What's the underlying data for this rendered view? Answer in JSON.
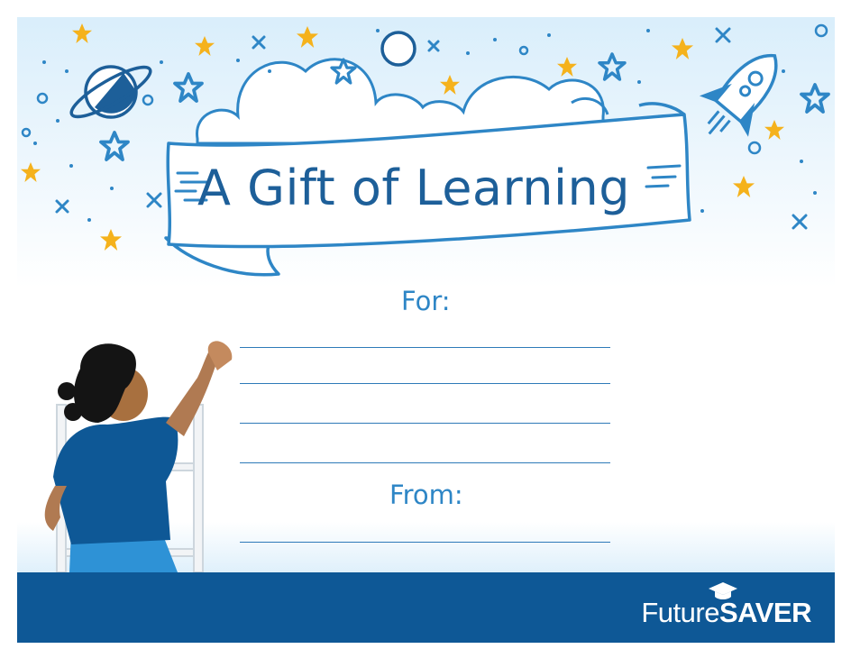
{
  "title": "A Gift of Learning",
  "labels": {
    "for": "For:",
    "from": "From:"
  },
  "brand": {
    "part1": "Future",
    "part2": "SAVER"
  },
  "icons": [
    "planet-icon",
    "rocket-icon",
    "star-icon",
    "cloud-icon",
    "banner-icon",
    "graduation-cap-icon"
  ],
  "colors": {
    "footer": "#0e5896",
    "title": "#1d5f99",
    "label": "#2e86c6",
    "star": "#f5b21c",
    "outline": "#2e86c6"
  }
}
